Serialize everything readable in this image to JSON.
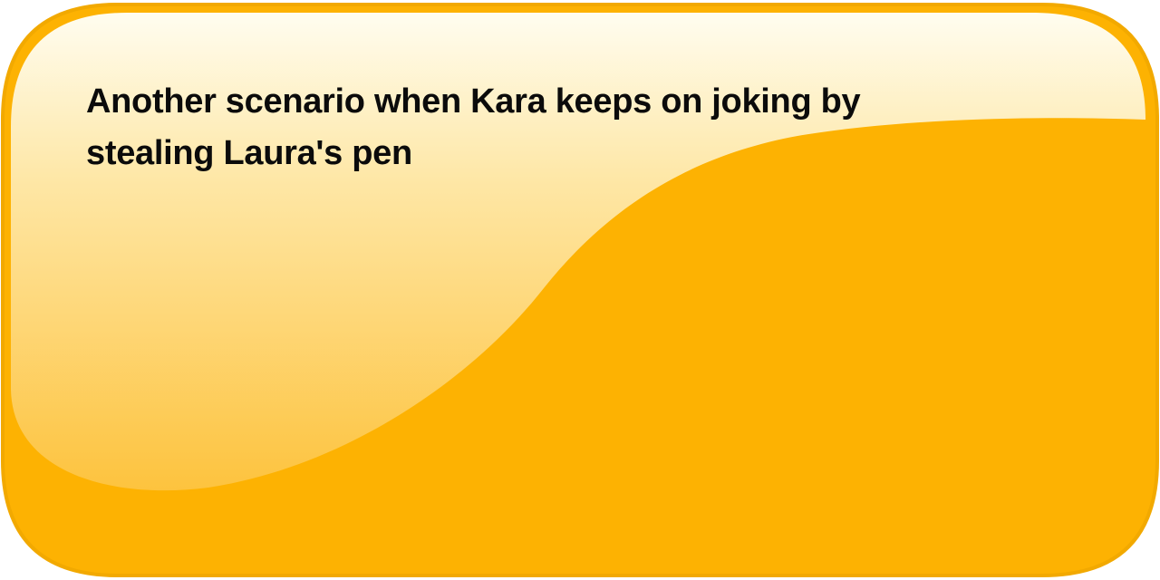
{
  "slide": {
    "text": "Another scenario when Kara keeps on joking by stealing Laura's pen",
    "colors": {
      "fill": "#FDB202",
      "border": "#F2A900",
      "highlight_top": "#FFFDF0",
      "highlight_bottom": "#FDC33E"
    }
  }
}
